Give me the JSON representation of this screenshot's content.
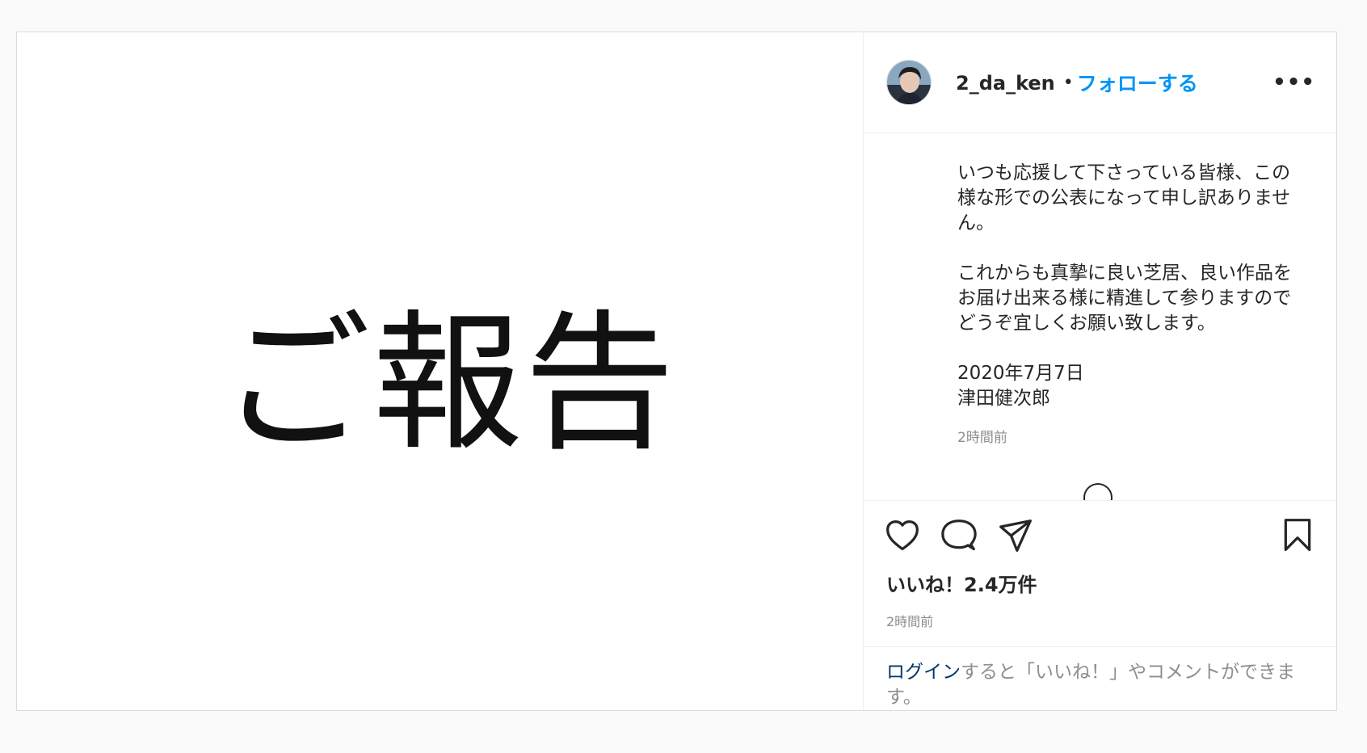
{
  "post": {
    "image_text": "ご報告",
    "username": "2_da_ken",
    "separator": "•",
    "follow_label": "フォローする",
    "more_label": "•••",
    "caption": {
      "paragraph1": "いつも応援して下さっている皆様、この様な形での公表になって申し訳ありません。",
      "paragraph2": "これからも真摯に良い芝居、良い作品をお届け出来る様に精進して参りますのでどうぞ宜しくお願い致します。",
      "date_line": "2020年7月7日",
      "signature": "津田健次郎",
      "time": "2時間前"
    },
    "likes_text": "いいね！2.4万件",
    "post_time": "2時間前",
    "login_prompt": {
      "link": "ログイン",
      "rest": "すると「いいね！」やコメントができます。"
    }
  },
  "colors": {
    "follow": "#0095f6",
    "link": "#00376b",
    "muted": "#8e8e8e"
  },
  "icons": [
    "heart-icon",
    "comment-icon",
    "share-icon",
    "bookmark-icon",
    "more-icon",
    "load-more-icon"
  ]
}
